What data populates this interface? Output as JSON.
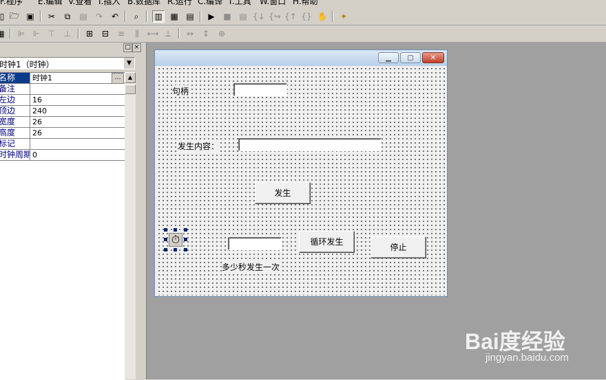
{
  "menu": [
    "F.程序",
    "E.编辑",
    "V.查看",
    "I.插入",
    "B.数据库",
    "R.运行",
    "C.编译",
    "T.工具",
    "W.窗口",
    "H.帮助"
  ],
  "toolbar1": [
    "new-icon",
    "open-icon",
    "save-icon",
    "cut-icon",
    "copy-icon",
    "paste-icon",
    "redo-icon",
    "undo-icon",
    "find-icon",
    "layout1-icon",
    "layout2-icon",
    "layout3-icon",
    "run-icon",
    "stop-icon",
    "step1-icon",
    "step2-icon",
    "step3-icon",
    "step4-icon",
    "step5-icon",
    "hand-icon",
    "wizard-icon"
  ],
  "property_panel": {
    "selected_object": "时钟1（时钟）",
    "rows": [
      {
        "name": "名称",
        "value": "时钟1"
      },
      {
        "name": "备注",
        "value": ""
      },
      {
        "name": "左边",
        "value": "16"
      },
      {
        "name": "顶边",
        "value": "240"
      },
      {
        "name": "宽度",
        "value": "26"
      },
      {
        "name": "高度",
        "value": "26"
      },
      {
        "name": "标记",
        "value": ""
      },
      {
        "name": "时钟周期",
        "value": "0"
      }
    ]
  },
  "form": {
    "label_handle": "句柄",
    "label_content": "发生内容：",
    "button_fire": "发生",
    "button_loop": "循环发生",
    "button_stop": "停止",
    "label_interval": "多少秒发生一次",
    "titlebar_buttons": [
      "min",
      "max",
      "close"
    ]
  },
  "watermark": {
    "logo": "Bai度经验",
    "sub": "jingyan.baidu.com"
  },
  "colors": {
    "selection": "#0a3a8c",
    "workspace": "#a0a0a0",
    "face": "#d4d0c8"
  }
}
